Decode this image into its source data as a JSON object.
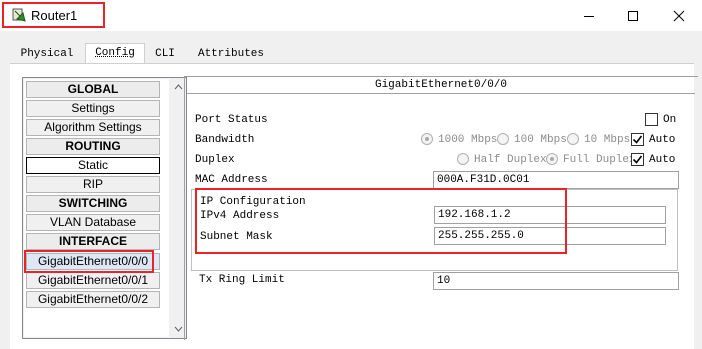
{
  "window": {
    "title": "Router1",
    "controls": {
      "minimize": "minimize",
      "maximize": "maximize",
      "close": "close"
    }
  },
  "tabs": [
    "Physical",
    "Config",
    "CLI",
    "Attributes"
  ],
  "nav": {
    "global_header": "GLOBAL",
    "settings": "Settings",
    "algorithm_settings": "Algorithm Settings",
    "routing_header": "ROUTING",
    "static": "Static",
    "rip": "RIP",
    "switching_header": "SWITCHING",
    "vlan_database": "VLAN Database",
    "interface_header": "INTERFACE",
    "interfaces": [
      "GigabitEthernet0/0/0",
      "GigabitEthernet0/0/1",
      "GigabitEthernet0/0/2"
    ]
  },
  "panel": {
    "title": "GigabitEthernet0/0/0",
    "port_status_label": "Port Status",
    "on_label": "On",
    "bandwidth_label": "Bandwidth",
    "bandwidth_options": [
      "1000 Mbps",
      "100 Mbps",
      "10 Mbps"
    ],
    "auto_label": "Auto",
    "duplex_label": "Duplex",
    "duplex_options": [
      "Half Duplex",
      "Full Duplex"
    ],
    "mac_label": "MAC Address",
    "mac_value": "000A.F31D.0C01",
    "ip_config_label": "IP Configuration",
    "ipv4_label": "IPv4 Address",
    "ipv4_value": "192.168.1.2",
    "subnet_label": "Subnet Mask",
    "subnet_value": "255.255.255.0",
    "tx_ring_label": "Tx Ring Limit",
    "tx_ring_value": "10"
  },
  "colors": {
    "highlight": "#e8242b",
    "window_bg": "#f0f0f0"
  }
}
